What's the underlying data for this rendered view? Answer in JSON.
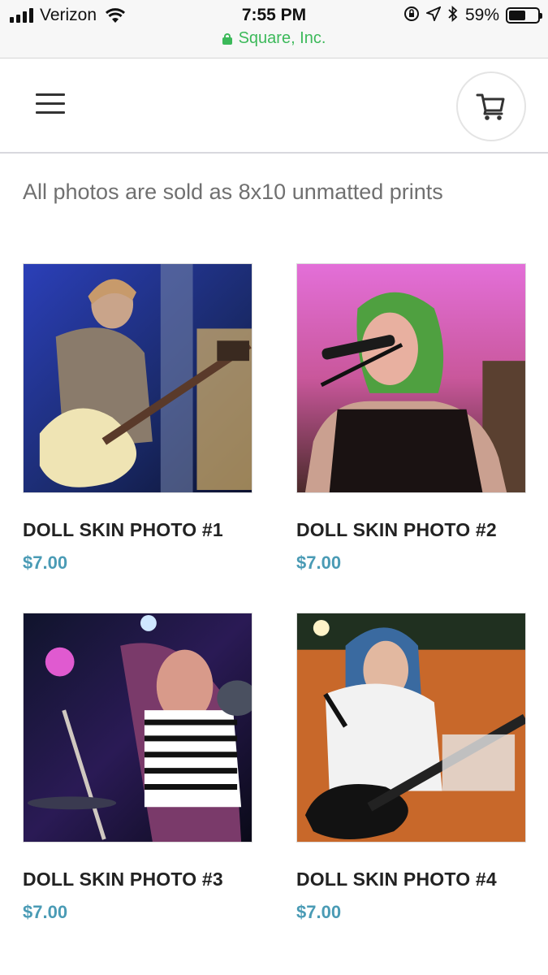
{
  "status_bar": {
    "carrier": "Verizon",
    "time": "7:55 PM",
    "battery_percent": "59%",
    "battery_level": 0.59,
    "url": "Square, Inc.",
    "icons": [
      "signal-icon",
      "wifi-icon",
      "rotation-lock-icon",
      "location-icon",
      "bluetooth-icon",
      "battery-icon",
      "lock-icon"
    ]
  },
  "header": {
    "menu_icon": "hamburger-menu-icon",
    "cart_icon": "cart-icon"
  },
  "intro_text": "All photos are sold as 8x10 unmatted prints",
  "products": [
    {
      "title": "DOLL SKIN PHOTO #1",
      "price": "$7.00"
    },
    {
      "title": "DOLL SKIN PHOTO #2",
      "price": "$7.00"
    },
    {
      "title": "DOLL SKIN PHOTO #3",
      "price": "$7.00"
    },
    {
      "title": "DOLL SKIN PHOTO #4",
      "price": "$7.00"
    }
  ],
  "colors": {
    "price": "#4a9bb5",
    "secure_url": "#3cb95a"
  }
}
